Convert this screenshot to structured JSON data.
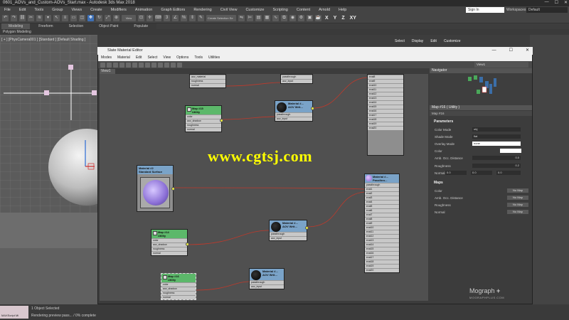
{
  "app": {
    "title": "0601_AOVs_and_Custom-AOVs_Start.max - Autodesk 3ds Max 2018",
    "signin": "Sign In",
    "workspaces_label": "Workspaces:",
    "workspace_value": "Default"
  },
  "menu": [
    "File",
    "Edit",
    "Tools",
    "Group",
    "Views",
    "Create",
    "Modifiers",
    "Animation",
    "Graph Editors",
    "Rendering",
    "Civil View",
    "Customize",
    "Scripting",
    "Content",
    "Arnold",
    "Help"
  ],
  "toolbar": {
    "xyz": [
      "X",
      "Y",
      "Z",
      "XY"
    ],
    "view_label": "View",
    "selection_set": "Create Selection Se"
  },
  "ribbon": {
    "tabs": [
      "Modeling",
      "Freeform",
      "Selection",
      "Object Paint",
      "Populate"
    ],
    "polygon": "Polygon Modeling"
  },
  "viewport": {
    "label": "[ + ] [PhysCamera001 ] [Standard ] [Default Shading ]"
  },
  "command_tabs": [
    "Select",
    "Display",
    "Edit",
    "Customize"
  ],
  "sme": {
    "title": "Slate Material Editor",
    "menu": [
      "Modes",
      "Material",
      "Edit",
      "Select",
      "View",
      "Options",
      "Tools",
      "Utilities"
    ],
    "view_tab": "View1",
    "view_select": "View1"
  },
  "nodes": {
    "map15": {
      "title1": "Map #15",
      "title2": "Utility"
    },
    "map14": {
      "title1": "Map #14",
      "title2": "Utility"
    },
    "map16": {
      "title1": "Map #16",
      "title2": "Utility"
    },
    "mat2": {
      "title1": "Material #2",
      "title2": "Standard Surface"
    },
    "aov1": {
      "title1": "Material #...",
      "title2": "AOV Writ..."
    },
    "aov2": {
      "title1": "Material #...",
      "title2": "AOV Writ..."
    },
    "aov3": {
      "title1": "Material #...",
      "title2": "AOV Writ..."
    },
    "passthrough": {
      "title1": "Material #...",
      "title2": "Passthro..."
    },
    "top_partial": {
      "rows": [
        "aov_material",
        "roughness",
        "normal"
      ]
    },
    "top_aov": {
      "rows": [
        "passthrough",
        "aov_input"
      ]
    },
    "utility_rows": [
      "color",
      "aov_shadow",
      "roughness",
      "normal"
    ],
    "aov_rows": [
      "passthrough",
      "aov_input"
    ],
    "eval_upper": [
      "eval8",
      "eval9",
      "eval10",
      "eval11",
      "eval12",
      "eval13",
      "eval14",
      "eval15",
      "eval16",
      "eval17",
      "eval18",
      "eval19",
      "eval20"
    ],
    "pass_rows": [
      "passthrough",
      "eval1",
      "eval2",
      "eval3",
      "eval4",
      "eval5",
      "eval6",
      "eval7",
      "eval8",
      "eval9",
      "eval10",
      "eval11",
      "eval12",
      "eval13",
      "eval14",
      "eval15",
      "eval16",
      "eval17",
      "eval18",
      "eval19",
      "eval20"
    ]
  },
  "watermark": "www.cgtsj.com",
  "mograph": {
    "brand": "Mograph",
    "plus": "+",
    "sub": "MOGRAPHPLUS.COM"
  },
  "navigator": {
    "title": "Navigator"
  },
  "properties": {
    "title": "Map #16 ( Utility )",
    "subtitle": "Map #16",
    "parameters": "Parameters",
    "color_mode_label": "Color Mode",
    "color_mode": "obj",
    "shade_mode_label": "Shade Mode",
    "shade_mode": "flat",
    "overlay_label": "Overlay Mode",
    "overlay": "none",
    "color_label": "Color",
    "ao_label": "Amb. Occ. Distance",
    "ao_value": "0.0",
    "roughness_label": "Roughness",
    "roughness_value": "0.2",
    "normal_label": "Normal",
    "normal_values": [
      "0.0",
      "0.0",
      "0.0"
    ],
    "maps": "Maps",
    "maps_items": [
      "Color",
      "Amb. Occ. Distance",
      "Roughness",
      "Normal"
    ],
    "no_map": "No Map"
  },
  "status": {
    "selected": "1 Object Selected",
    "rendering": "Rendering preview pass... / 0% complete",
    "maxscript": "MAXScript Mi"
  },
  "colors": {
    "accent": "#3d6fb5",
    "watermark": "#ffff00",
    "wire": "#c0392b"
  }
}
